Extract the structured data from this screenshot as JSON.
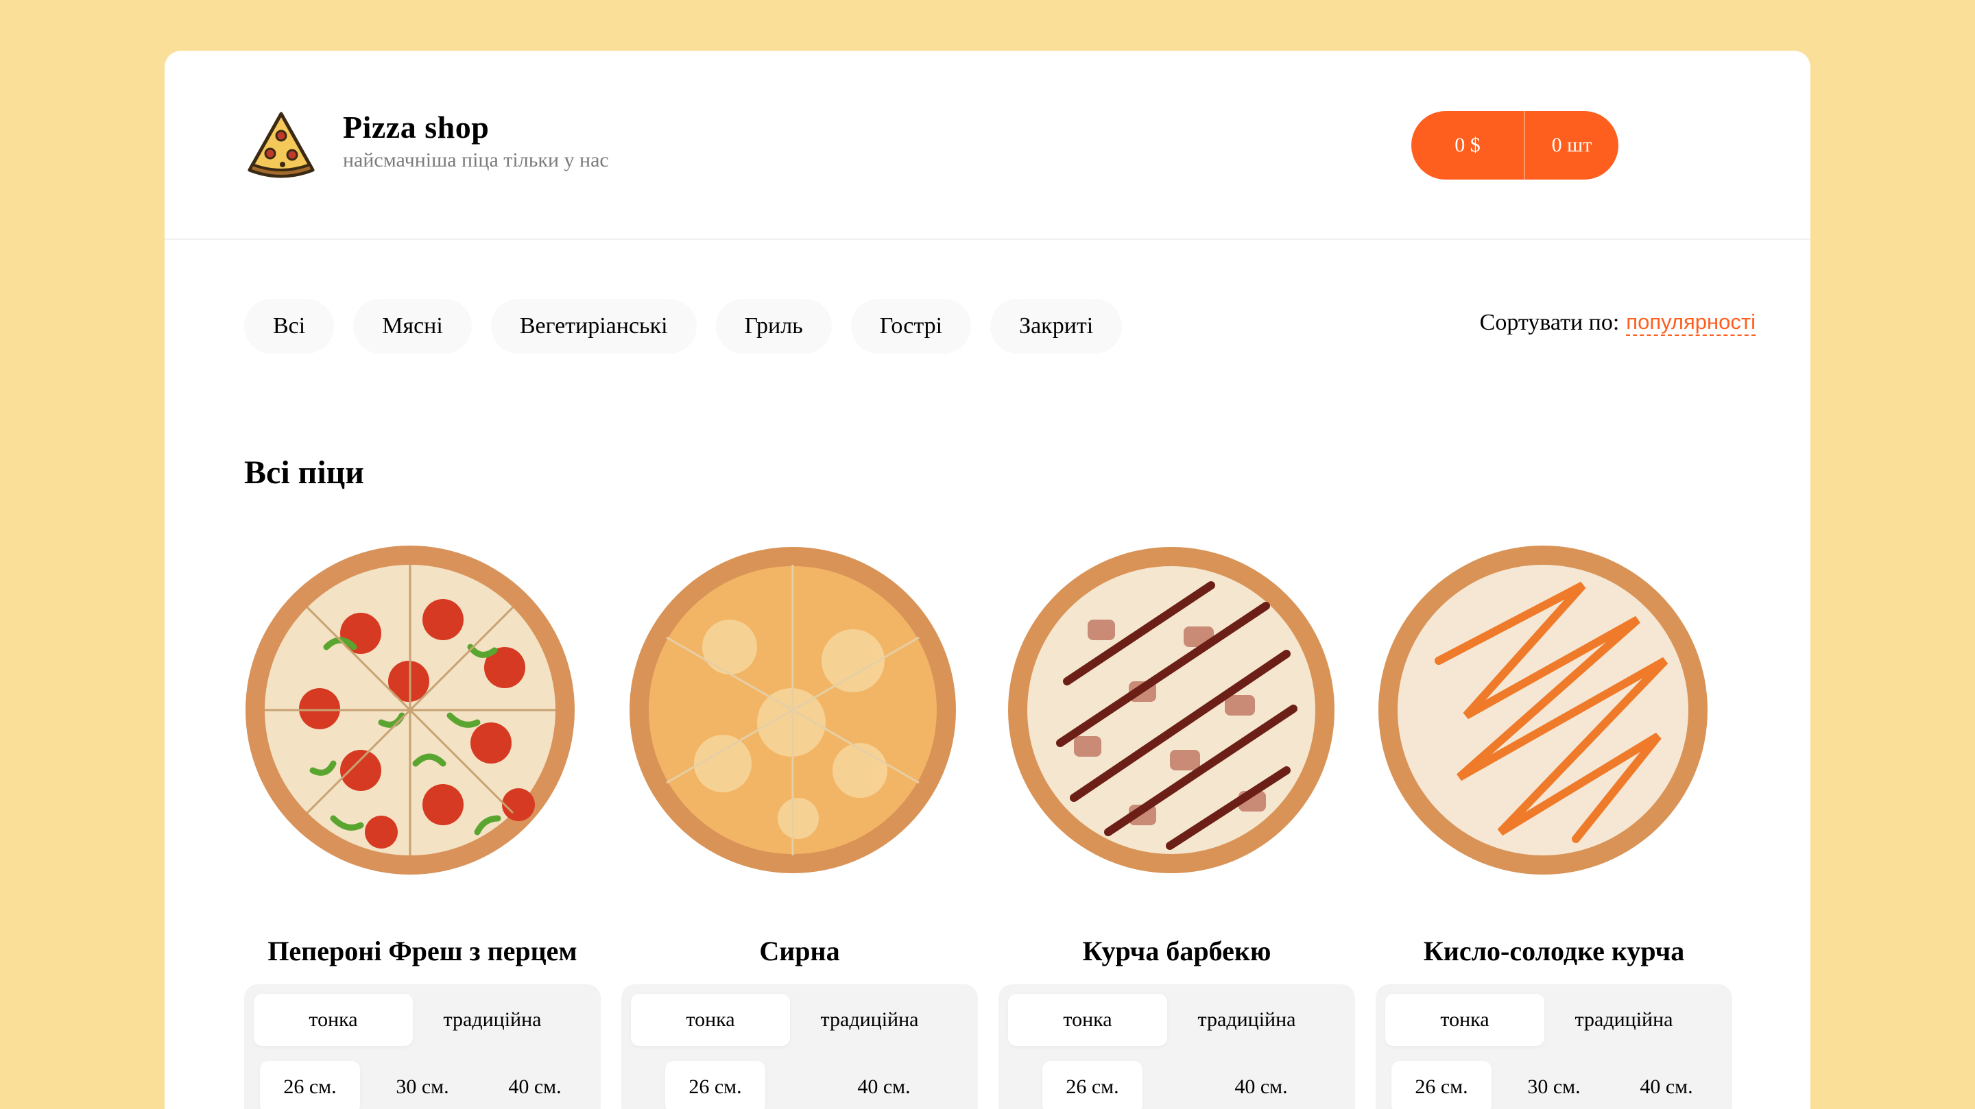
{
  "header": {
    "title": "Pizza shop",
    "subtitle": "найсмачніша піца тільки у нас",
    "cart_price": "0 $",
    "cart_count": "0 шт"
  },
  "categories": [
    "Всі",
    "Мясні",
    "Вегетиріанські",
    "Гриль",
    "Гострі",
    "Закриті"
  ],
  "sort": {
    "label": "Сортувати по:",
    "value": "популярності"
  },
  "section_title": "Всі піци",
  "pizzas": [
    {
      "name": "Пепероні Фреш з перцем",
      "dough": [
        "тонка",
        "традиційна"
      ],
      "sizes": [
        "26 см.",
        "30 см.",
        "40 см."
      ],
      "image": "pepperoni-pizza-image"
    },
    {
      "name": "Сирна",
      "dough": [
        "тонка",
        "традиційна"
      ],
      "sizes": [
        "26 см.",
        "40 см."
      ],
      "image": "cheese-pizza-image"
    },
    {
      "name": "Курча барбекю",
      "dough": [
        "тонка",
        "традиційна"
      ],
      "sizes": [
        "26 см.",
        "40 см."
      ],
      "image": "bbq-chicken-pizza-image"
    },
    {
      "name": "Кисло-солодке курча",
      "dough": [
        "тонка",
        "традиційна"
      ],
      "sizes": [
        "26 см.",
        "30 см.",
        "40 см."
      ],
      "image": "sweet-sour-chicken-pizza-image"
    }
  ],
  "colors": {
    "accent": "#fe5f1e",
    "background": "#fadf98"
  }
}
